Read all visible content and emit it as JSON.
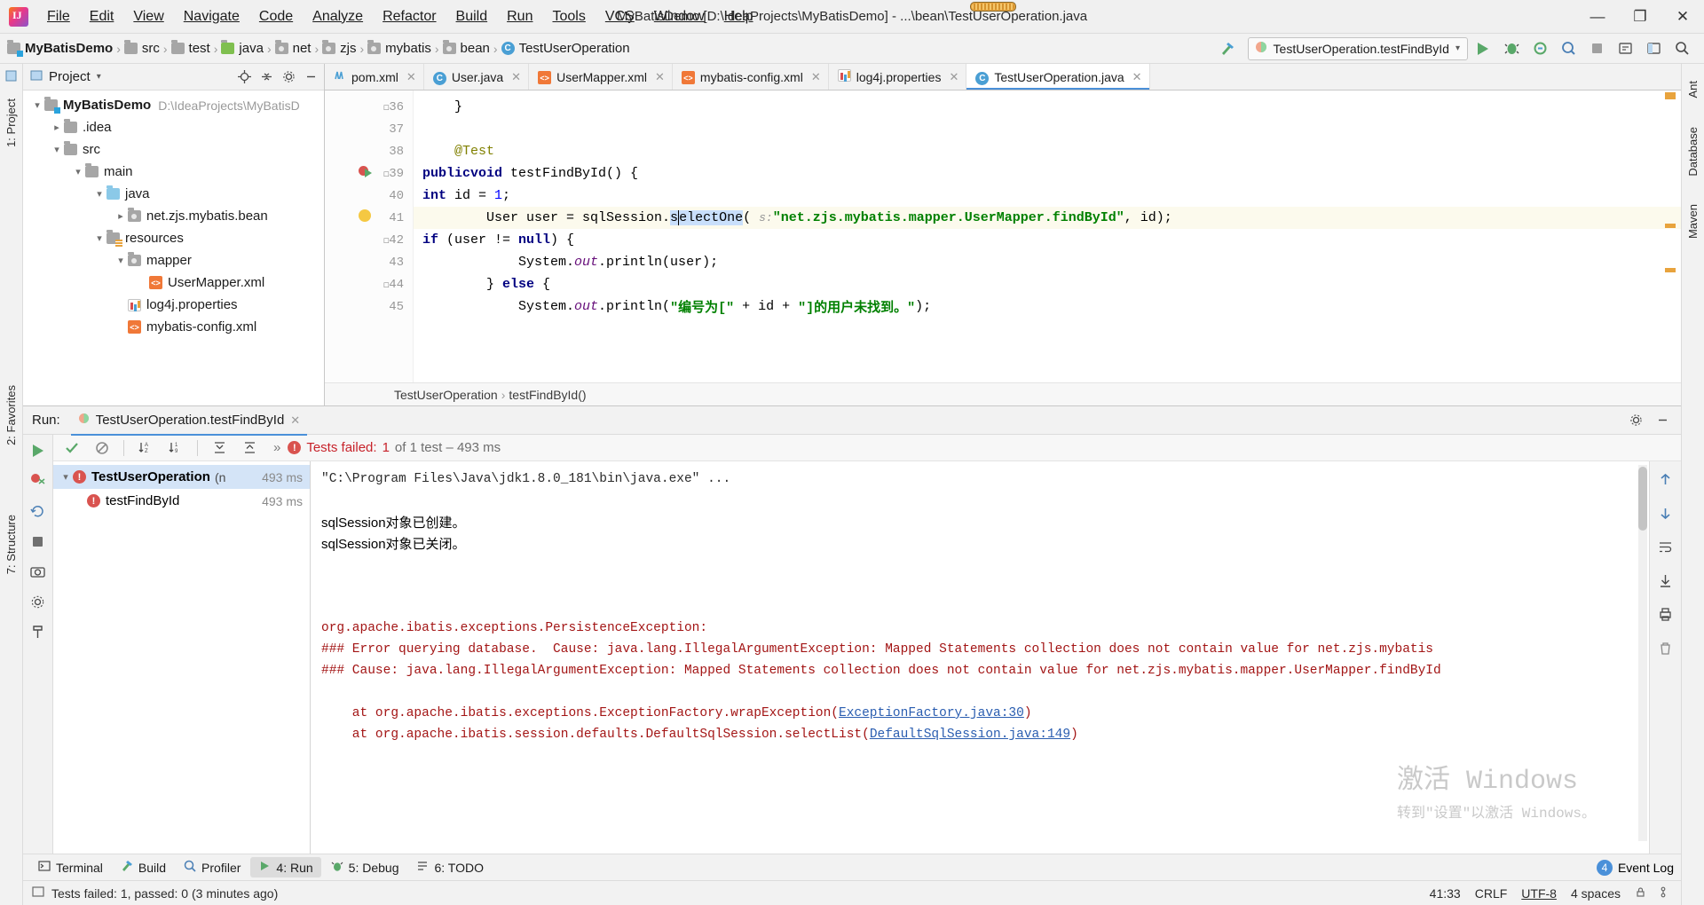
{
  "window": {
    "title": "MyBatisDemo [D:\\IdeaProjects\\MyBatisDemo] - ...\\bean\\TestUserOperation.java",
    "minimize": "—",
    "maximize": "❐",
    "close": "✕"
  },
  "menu": [
    "File",
    "Edit",
    "View",
    "Navigate",
    "Code",
    "Analyze",
    "Refactor",
    "Build",
    "Run",
    "Tools",
    "VCS",
    "Window",
    "Help"
  ],
  "breadcrumb": [
    {
      "label": "MyBatisDemo",
      "icon": "module-folder-icon"
    },
    {
      "label": "src",
      "icon": "folder-icon"
    },
    {
      "label": "test",
      "icon": "folder-icon"
    },
    {
      "label": "java",
      "icon": "source-folder-icon"
    },
    {
      "label": "net",
      "icon": "package-icon"
    },
    {
      "label": "zjs",
      "icon": "package-icon"
    },
    {
      "label": "mybatis",
      "icon": "package-icon"
    },
    {
      "label": "bean",
      "icon": "package-icon"
    },
    {
      "label": "TestUserOperation",
      "icon": "test-class-icon"
    }
  ],
  "toolbar": {
    "run_config": "TestUserOperation.testFindById",
    "icons": [
      "hammer-icon",
      "run-icon",
      "debug-icon",
      "run-coverage-icon",
      "profile-icon",
      "stop-icon",
      "select-opened-file-icon",
      "layout-icon",
      "search-icon"
    ]
  },
  "project_panel": {
    "title": "Project",
    "tree": [
      {
        "depth": 0,
        "arrow": "down",
        "label": "MyBatisDemo",
        "icon": "module-folder-icon",
        "bold": true,
        "path": "D:\\IdeaProjects\\MyBatisD"
      },
      {
        "depth": 1,
        "arrow": "right",
        "label": ".idea",
        "icon": "folder-icon",
        "bold": false,
        "path": ""
      },
      {
        "depth": 1,
        "arrow": "down",
        "label": "src",
        "icon": "folder-icon",
        "bold": false,
        "path": ""
      },
      {
        "depth": 2,
        "arrow": "down",
        "label": "main",
        "icon": "folder-icon",
        "bold": false,
        "path": ""
      },
      {
        "depth": 3,
        "arrow": "down",
        "label": "java",
        "icon": "source-folder-icon",
        "bold": false,
        "path": ""
      },
      {
        "depth": 4,
        "arrow": "right",
        "label": "net.zjs.mybatis.bean",
        "icon": "package-icon",
        "bold": false,
        "path": ""
      },
      {
        "depth": 3,
        "arrow": "down",
        "label": "resources",
        "icon": "resources-folder-icon",
        "bold": false,
        "path": ""
      },
      {
        "depth": 4,
        "arrow": "down",
        "label": "mapper",
        "icon": "package-icon",
        "bold": false,
        "path": ""
      },
      {
        "depth": 5,
        "arrow": "none",
        "label": "UserMapper.xml",
        "icon": "xml-file-icon",
        "bold": false,
        "path": ""
      },
      {
        "depth": 4,
        "arrow": "none",
        "label": "log4j.properties",
        "icon": "properties-file-icon",
        "bold": false,
        "path": ""
      },
      {
        "depth": 4,
        "arrow": "none",
        "label": "mybatis-config.xml",
        "icon": "xml-file-icon",
        "bold": false,
        "path": ""
      }
    ]
  },
  "editor": {
    "tabs": [
      {
        "label": "pom.xml",
        "icon": "maven-icon",
        "active": false
      },
      {
        "label": "User.java",
        "icon": "java-class-icon",
        "active": false
      },
      {
        "label": "UserMapper.xml",
        "icon": "xml-file-icon",
        "active": false
      },
      {
        "label": "mybatis-config.xml",
        "icon": "xml-file-icon",
        "active": false
      },
      {
        "label": "log4j.properties",
        "icon": "properties-file-icon",
        "active": false
      },
      {
        "label": "TestUserOperation.java",
        "icon": "java-class-icon",
        "active": true
      }
    ],
    "lines": [
      {
        "num": "36",
        "text": "    }",
        "marker": "",
        "fold": "minus"
      },
      {
        "num": "37",
        "text": "",
        "marker": "",
        "fold": ""
      },
      {
        "num": "38",
        "text": "    @Test",
        "marker": "",
        "fold": ""
      },
      {
        "num": "39",
        "text": "    public void testFindById() {",
        "marker": "run",
        "fold": "minus"
      },
      {
        "num": "40",
        "text": "        int id = 1;",
        "marker": "",
        "fold": ""
      },
      {
        "num": "41",
        "text": "        User user = sqlSession.selectOne( s: \"net.zjs.mybatis.mapper.UserMapper.findById\", id);",
        "marker": "bulb",
        "fold": "",
        "highlight": true
      },
      {
        "num": "42",
        "text": "        if (user != null) {",
        "marker": "",
        "fold": "minus"
      },
      {
        "num": "43",
        "text": "            System.out.println(user);",
        "marker": "",
        "fold": ""
      },
      {
        "num": "44",
        "text": "        } else {",
        "marker": "",
        "fold": "minus"
      },
      {
        "num": "45",
        "text": "            System.out.println(\"编号为[\" + id + \"]的用户未找到。\");",
        "marker": "",
        "fold": ""
      }
    ],
    "breadcrumb": [
      "TestUserOperation",
      "testFindById()"
    ],
    "param_hint": "s:"
  },
  "run_window": {
    "label": "Run:",
    "tab": "TestUserOperation.testFindById",
    "status": {
      "failed_prefix": "Tests failed:",
      "failed_count": "1",
      "detail": "of 1 test – 493 ms"
    },
    "test_tree": [
      {
        "depth": 0,
        "label": "TestUserOperation",
        "suffix": "(n",
        "duration": "493 ms",
        "selected": true
      },
      {
        "depth": 1,
        "label": "testFindById",
        "suffix": "",
        "duration": "493 ms",
        "selected": false
      }
    ],
    "console": [
      {
        "type": "cmd",
        "text": "\"C:\\Program Files\\Java\\jdk1.8.0_181\\bin\\java.exe\" ..."
      },
      {
        "type": "blank",
        "text": ""
      },
      {
        "type": "out",
        "text": "sqlSession对象已创建。"
      },
      {
        "type": "out",
        "text": "sqlSession对象已关闭。"
      },
      {
        "type": "blank",
        "text": ""
      },
      {
        "type": "blank",
        "text": ""
      },
      {
        "type": "blank",
        "text": ""
      },
      {
        "type": "err",
        "text": "org.apache.ibatis.exceptions.PersistenceException:"
      },
      {
        "type": "err",
        "text": "### Error querying database.  Cause: java.lang.IllegalArgumentException: Mapped Statements collection does not contain value for net.zjs.mybatis"
      },
      {
        "type": "err",
        "text": "### Cause: java.lang.IllegalArgumentException: Mapped Statements collection does not contain value for net.zjs.mybatis.mapper.UserMapper.findById"
      },
      {
        "type": "blank",
        "text": ""
      },
      {
        "type": "trace",
        "prefix": "    at org.apache.ibatis.exceptions.ExceptionFactory.wrapException(",
        "link": "ExceptionFactory.java:30",
        "suffix": ")"
      },
      {
        "type": "trace",
        "prefix": "    at org.apache.ibatis.session.defaults.DefaultSqlSession.selectList(",
        "link": "DefaultSqlSession.java:149",
        "suffix": ")"
      }
    ]
  },
  "watermark": {
    "line1": "激活 Windows",
    "line2": "转到\"设置\"以激活 Windows。"
  },
  "left_strip": [
    {
      "label": "1: Project",
      "icon": "project-icon"
    },
    {
      "label": "2: Favorites",
      "icon": "star-icon"
    },
    {
      "label": "7: Structure",
      "icon": "structure-icon"
    }
  ],
  "right_strip": [
    {
      "label": "Ant",
      "icon": "ant-icon"
    },
    {
      "label": "Database",
      "icon": "database-icon"
    },
    {
      "label": "Maven",
      "icon": "maven-icon"
    }
  ],
  "toolwindow_bar": {
    "items": [
      {
        "label": "Terminal",
        "icon": "terminal-icon",
        "active": false,
        "accel": ""
      },
      {
        "label": "Build",
        "icon": "build-icon",
        "active": false,
        "accel": ""
      },
      {
        "label": "Profiler",
        "icon": "profiler-icon",
        "active": false,
        "accel": ""
      },
      {
        "label": "4: Run",
        "icon": "run-icon",
        "active": true,
        "accel": "4"
      },
      {
        "label": "5: Debug",
        "icon": "debug-icon",
        "active": false,
        "accel": "5"
      },
      {
        "label": "6: TODO",
        "icon": "todo-icon",
        "active": false,
        "accel": "6"
      }
    ],
    "event_log": {
      "label": "Event Log",
      "count": "4"
    }
  },
  "statusbar": {
    "message": "Tests failed: 1, passed: 0 (3 minutes ago)",
    "position": "41:33",
    "line_sep": "CRLF",
    "encoding": "UTF-8",
    "indent": "4 spaces"
  }
}
